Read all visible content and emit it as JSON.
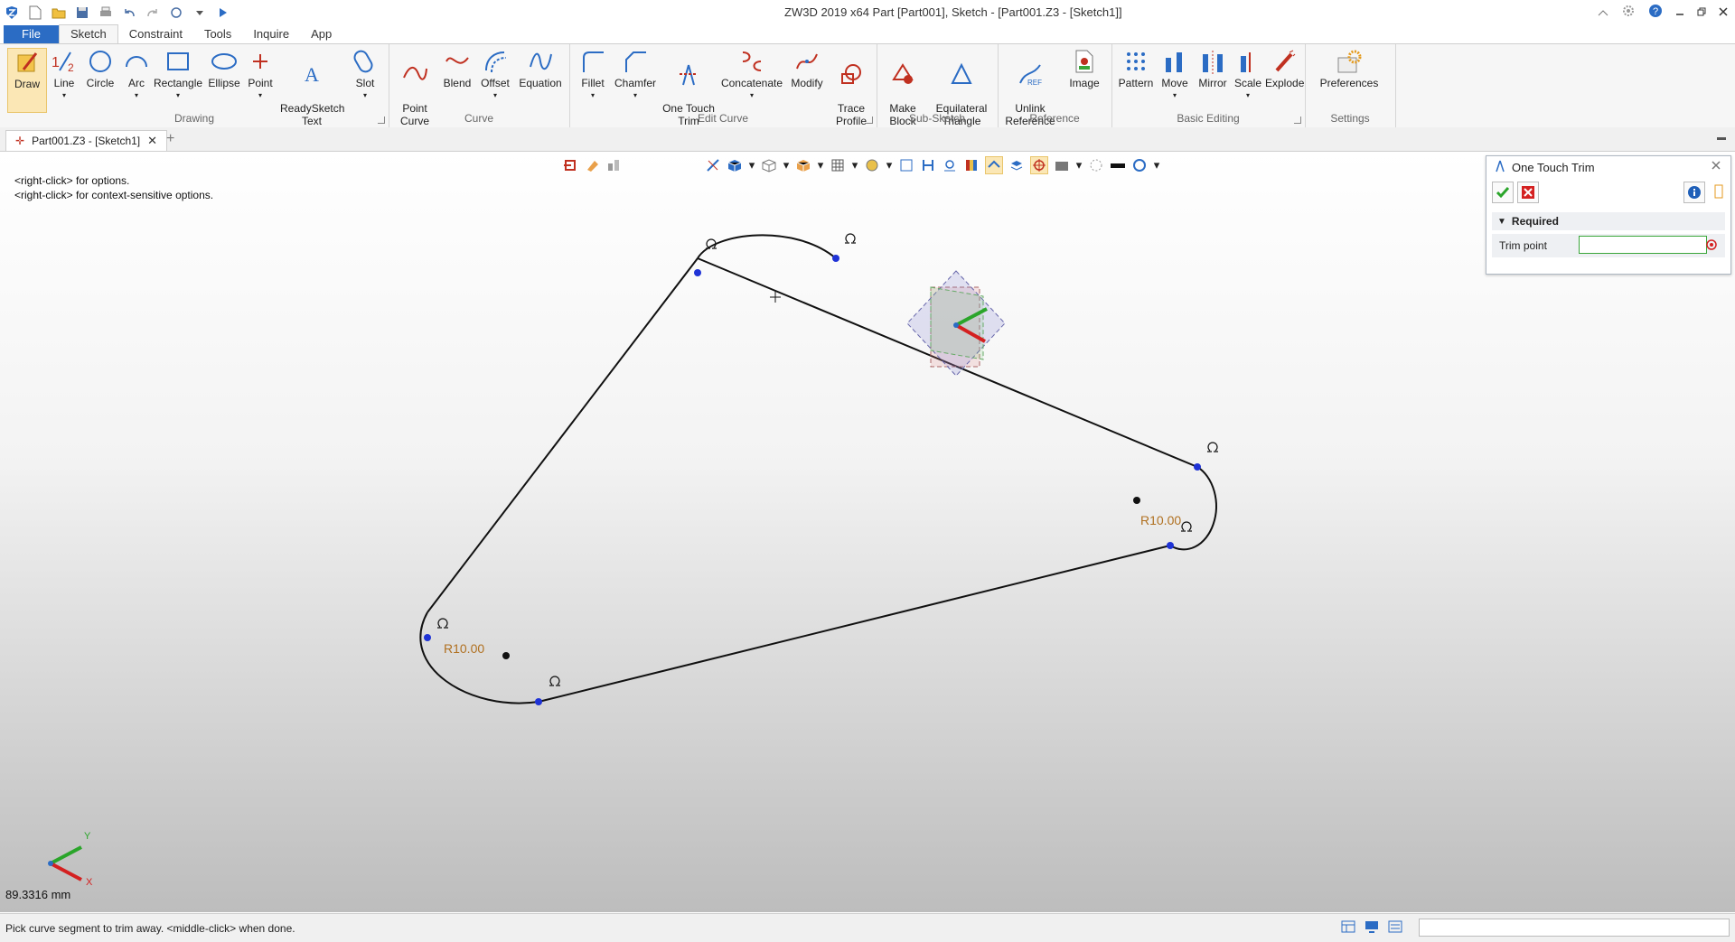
{
  "window": {
    "title": "ZW3D 2019  x64        Part [Part001],  Sketch - [Part001.Z3 - [Sketch1]]"
  },
  "menu": {
    "file": "File",
    "tabs": [
      "Sketch",
      "Constraint",
      "Tools",
      "Inquire",
      "App"
    ]
  },
  "ribbon": {
    "groups": {
      "drawing": "Drawing",
      "curve": "Curve",
      "edit_curve": "Edit Curve",
      "sub_sketch": "Sub-Sketch",
      "reference": "Reference",
      "basic_editing": "Basic Editing",
      "settings": "Settings"
    },
    "tools": {
      "draw": "Draw",
      "line": "Line",
      "circle": "Circle",
      "arc": "Arc",
      "rectangle": "Rectangle",
      "ellipse": "Ellipse",
      "point": "Point",
      "readysketch_text": "ReadySketch\nText",
      "slot": "Slot",
      "point_curve": "Point\nCurve",
      "blend": "Blend",
      "offset": "Offset",
      "equation": "Equation",
      "fillet": "Fillet",
      "chamfer": "Chamfer",
      "one_touch_trim": "One Touch\nTrim",
      "concatenate": "Concatenate",
      "modify": "Modify",
      "trace_profile": "Trace\nProfile",
      "make_block": "Make\nBlock",
      "equilateral_triangle": "Equilateral\nTriangle",
      "unlink_reference": "Unlink\nReference",
      "image": "Image",
      "pattern": "Pattern",
      "move": "Move",
      "mirror": "Mirror",
      "scale": "Scale",
      "explode": "Explode",
      "preferences": "Preferences"
    }
  },
  "doc_tab": {
    "label": "Part001.Z3 - [Sketch1]"
  },
  "viewport": {
    "hint1": "<right-click> for options.",
    "hint2": "<right-click> for context-sensitive options.",
    "dim1": "R10.00",
    "dim2": "R10.00",
    "measure": "89.3316 mm",
    "axis_x": "X",
    "axis_y": "Y"
  },
  "panel": {
    "title": "One Touch Trim",
    "section": "Required",
    "field_label": "Trim point",
    "field_value": ""
  },
  "status": {
    "prompt": "Pick curve segment to trim away.  <middle-click> when done."
  },
  "colors": {
    "file_tab": "#2b6cc4",
    "vertex": "#1f33d6",
    "dimension": "#b07020",
    "ok_green": "#2aa52a",
    "cancel_red": "#d42020"
  }
}
